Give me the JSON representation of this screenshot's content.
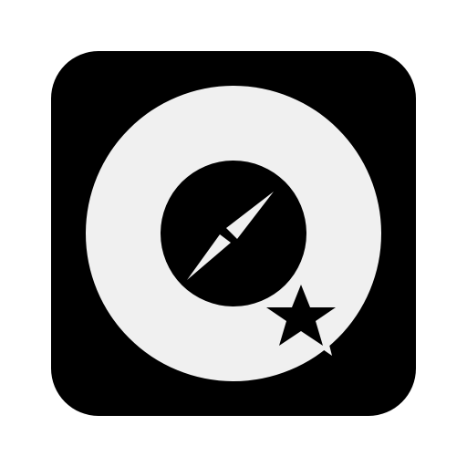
{
  "icon": {
    "name": "compass-favorite-app-icon",
    "tile_color": "#000000",
    "ring_color": "#f0f0f0",
    "needle_color": "#f0f0f0",
    "star_color": "#000000",
    "background_color": "#ffffff"
  }
}
